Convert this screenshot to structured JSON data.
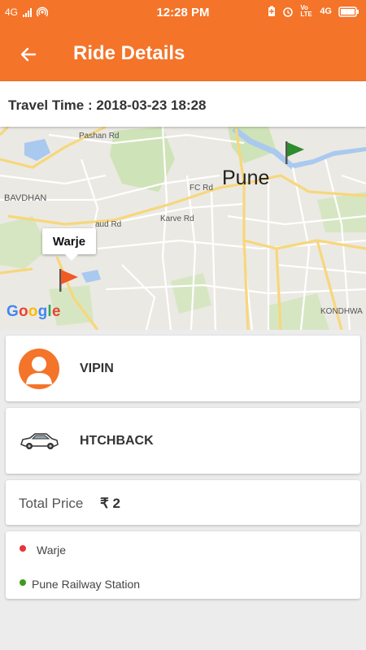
{
  "status_bar": {
    "network": "4G",
    "time": "12:28 PM",
    "volte": "Vo LTE",
    "network_right": "4G",
    "icons": [
      "signal-icon",
      "hotspot-icon",
      "battery-saver-icon",
      "alarm-icon",
      "volte-icon",
      "battery-icon"
    ]
  },
  "header": {
    "title": "Ride Details",
    "back_icon": "back-arrow-icon",
    "color": "#f47429"
  },
  "travel": {
    "text": "Travel Time : 2018-03-23  18:28"
  },
  "map": {
    "city_label": "Pune",
    "callout": "Warje",
    "logo": "Google",
    "labels": {
      "bavdhan": "BAVDHAN",
      "kondhwa": "KONDHWA",
      "pashan_rd": "Pashan Rd",
      "karve_rd": "Karve Rd",
      "paud_rd": "aud Rd",
      "fc_rd": "FC Rd"
    },
    "pickup_flag_color": "#f05a24",
    "drop_flag_color": "#2e8b2e"
  },
  "driver": {
    "name": "VIPIN",
    "avatar_icon": "person-icon"
  },
  "vehicle": {
    "type": "HTCHBACK",
    "icon": "car-icon"
  },
  "price": {
    "label": "Total Price",
    "value": "₹ 2"
  },
  "route": {
    "from": "Warje",
    "to": "Pune Railway Station",
    "from_color": "#e8323c",
    "to_color": "#3f9a21"
  }
}
